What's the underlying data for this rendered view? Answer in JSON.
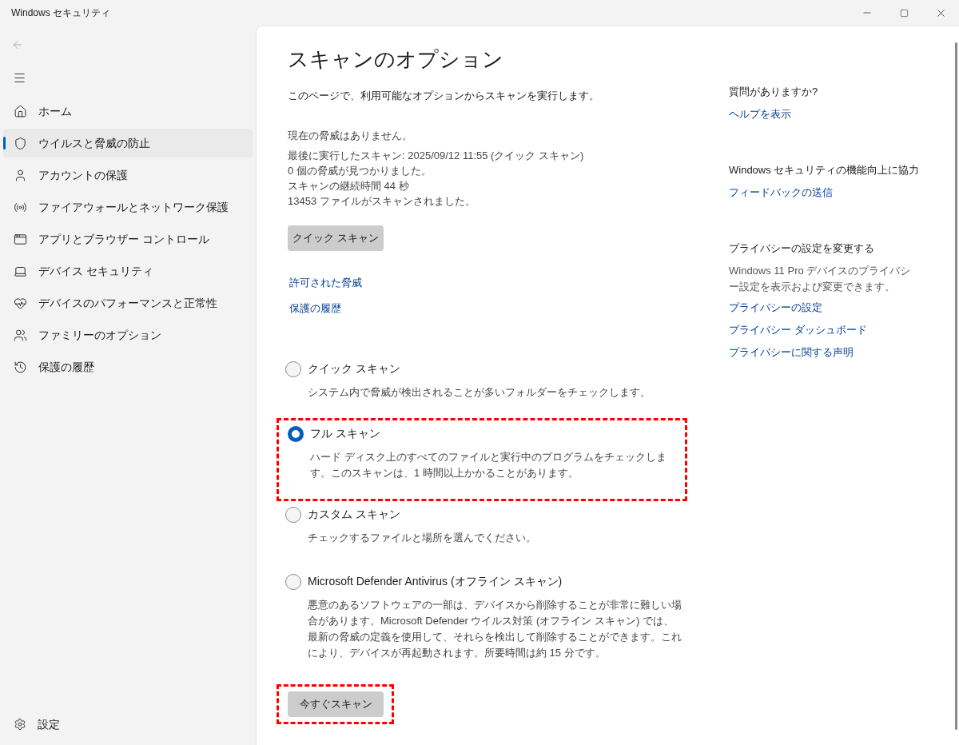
{
  "window": {
    "title": "Windows セキュリティ"
  },
  "sidebar": {
    "items": [
      {
        "label": "ホーム",
        "selected": false
      },
      {
        "label": "ウイルスと脅威の防止",
        "selected": true
      },
      {
        "label": "アカウントの保護",
        "selected": false
      },
      {
        "label": "ファイアウォールとネットワーク保護",
        "selected": false
      },
      {
        "label": "アプリとブラウザー コントロール",
        "selected": false
      },
      {
        "label": "デバイス セキュリティ",
        "selected": false
      },
      {
        "label": "デバイスのパフォーマンスと正常性",
        "selected": false
      },
      {
        "label": "ファミリーのオプション",
        "selected": false
      },
      {
        "label": "保護の履歴",
        "selected": false
      }
    ],
    "settings": "設定"
  },
  "main": {
    "title": "スキャンのオプション",
    "intro": "このページで、利用可能なオプションからスキャンを実行します。",
    "status_lines": [
      "現在の脅威はありません。",
      "最後に実行したスキャン: 2025/09/12 11:55 (クイック スキャン)",
      "0 個の脅威が見つかりました。",
      "スキャンの継続時間 44 秒",
      "13453 ファイルがスキャンされました。"
    ],
    "quick_scan_button": "クイック スキャン",
    "links": [
      "許可された脅威",
      "保護の履歴"
    ],
    "scan_options": [
      {
        "label": "クイック スキャン",
        "description": "システム内で脅威が検出されることが多いフォルダーをチェックします。",
        "selected": false,
        "highlighted": false
      },
      {
        "label": "フル スキャン",
        "description": "ハード ディスク上のすべてのファイルと実行中のプログラムをチェックします。このスキャンは、1 時間以上かかることがあります。",
        "selected": true,
        "highlighted": true
      },
      {
        "label": "カスタム スキャン",
        "description": "チェックするファイルと場所を選んでください。",
        "selected": false,
        "highlighted": false
      },
      {
        "label": "Microsoft Defender Antivirus (オフライン スキャン)",
        "description": "悪意のあるソフトウェアの一部は、デバイスから削除することが非常に難しい場合があります。Microsoft Defender ウイルス対策 (オフライン スキャン) では、最新の脅威の定義を使用して、それらを検出して削除することができます。これにより、デバイスが再起動されます。所要時間は約 15 分です。",
        "selected": false,
        "highlighted": false
      }
    ],
    "scan_now_button": {
      "label": "今すぐスキャン",
      "highlighted": true
    }
  },
  "aside": [
    {
      "heading": "質問がありますか?",
      "links": [
        "ヘルプを表示"
      ]
    },
    {
      "heading": "Windows セキュリティの機能向上に協力",
      "links": [
        "フィードバックの送信"
      ]
    },
    {
      "heading": "プライバシーの設定を変更する",
      "text": "Windows 11 Pro デバイスのプライバシー設定を表示および変更できます。",
      "links": [
        "プライバシーの設定",
        "プライバシー ダッシュボード",
        "プライバシーに関する声明"
      ]
    }
  ]
}
